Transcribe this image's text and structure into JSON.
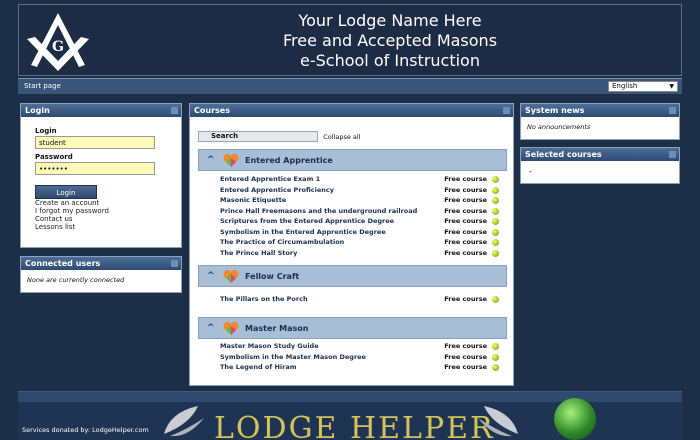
{
  "header": {
    "lines": [
      "Your Lodge Name Here",
      "Free and Accepted Masons",
      "e-School of Instruction"
    ]
  },
  "navbar": {
    "start_page": "Start page",
    "language": "English"
  },
  "login": {
    "title": "Login",
    "login_label": "Login",
    "login_value": "student",
    "password_label": "Password",
    "password_value": "•••••••",
    "button": "Login",
    "links": [
      "Create an account",
      "I forgot my password",
      "Contact us",
      "Lessons list"
    ]
  },
  "connected_users": {
    "title": "Connected users",
    "message": "None are currently connected"
  },
  "courses": {
    "title": "Courses",
    "search_label": "Search",
    "collapse_label": "Collapse all",
    "free_label": "Free course",
    "categories": [
      {
        "name": "Entered Apprentice",
        "courses": [
          "Entered Apprentice Exam 1",
          "Entered Apprentice Proficiency",
          "Masonic Etiquette",
          "Prince Hall Freemasons and the underground railroad",
          "Scriptures from the Entered Apprentice Degree",
          "Symbolism in the Entered Apprentice Degree",
          "The Practice of Circumambulation",
          "The Prince Hall Story"
        ]
      },
      {
        "name": "Fellow Craft",
        "courses": [
          "The Pillars on the Porch"
        ]
      },
      {
        "name": "Master Mason",
        "courses": [
          "Master Mason Study Guide",
          "Symbolism in the Master Mason Degree",
          "The Legend of Hiram"
        ]
      }
    ]
  },
  "system_news": {
    "title": "System news",
    "message": "No announcements"
  },
  "selected_courses": {
    "title": "Selected courses",
    "message": "-"
  },
  "footer": {
    "donated": "Services donated by: LodgeHelper.com",
    "brand": "LODGE HELPER"
  },
  "colors": {
    "background": "#1d2f47",
    "panel_header": "#3d5d86",
    "category_header": "#a8bdd6",
    "input_highlight": "#fdfab8"
  }
}
